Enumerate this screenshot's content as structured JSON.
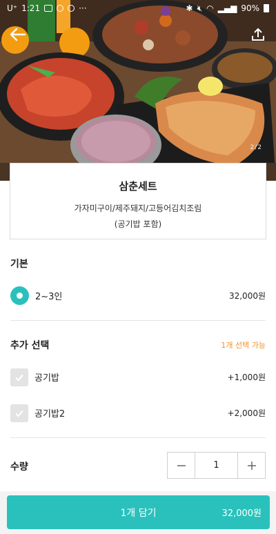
{
  "status_bar": {
    "carrier": "U⁺",
    "time": "1:21",
    "more": "···",
    "battery": "90%"
  },
  "hero": {
    "page_indicator": "2/2"
  },
  "menu": {
    "title": "삼춘세트",
    "description_line1": "가자미구이/제주돼지/고등어김치조림",
    "description_line2": "(공기밥 포함)"
  },
  "basic": {
    "section_title": "기본",
    "option_label": "2~3인",
    "option_price": "32,000원",
    "selected": true
  },
  "extra": {
    "section_title": "추가 선택",
    "limit_text": "1개 선택 가능",
    "options": [
      {
        "label": "공기밥",
        "price": "+1,000원",
        "checked": false
      },
      {
        "label": "공기밥2",
        "price": "+2,000원",
        "checked": false
      }
    ]
  },
  "quantity": {
    "label": "수량",
    "value": "1",
    "minus": "−",
    "plus": "+"
  },
  "cart_button": {
    "label": "1개 담기",
    "price": "32,000원"
  },
  "colors": {
    "accent": "#2ac1bc",
    "limit_text": "#f0902a"
  },
  "icons": [
    "back-arrow-icon",
    "share-icon",
    "check-icon",
    "radio-icon"
  ]
}
